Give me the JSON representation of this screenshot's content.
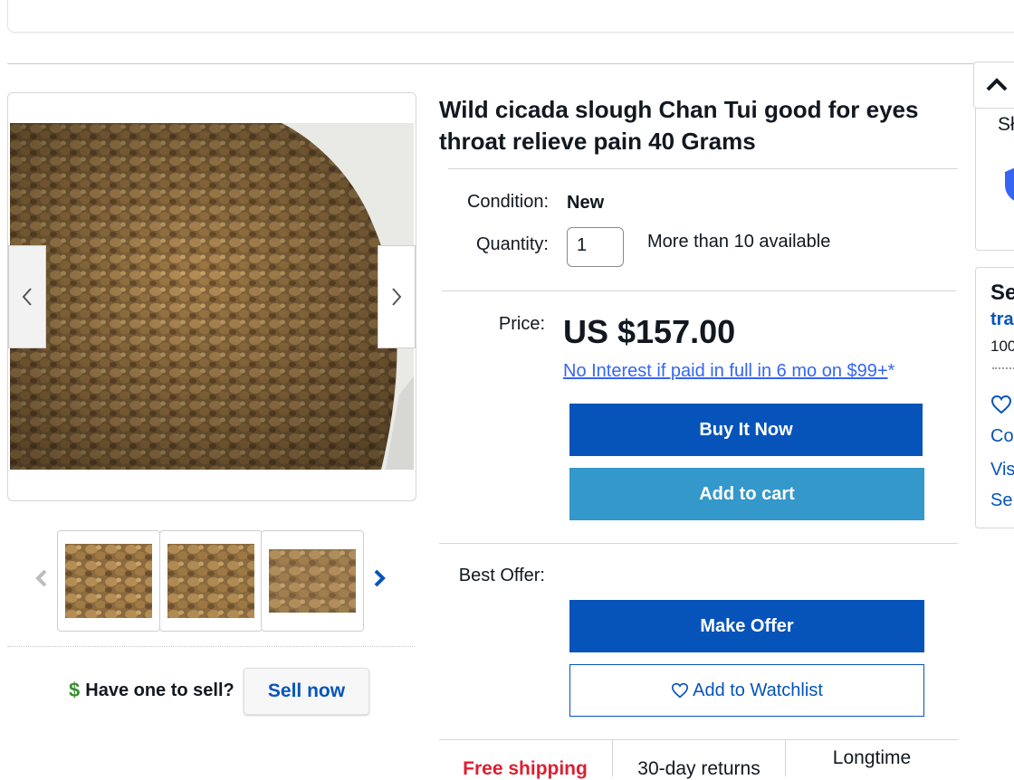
{
  "listing": {
    "title": "Wild cicada slough Chan Tui good for eyes throat relieve pain 40 Grams",
    "condition_label": "Condition:",
    "condition_value": "New",
    "quantity_label": "Quantity:",
    "quantity_value": "1",
    "availability": "More than 10 available",
    "price_label": "Price:",
    "price": "US $157.00",
    "financing_link": "No Interest if paid in full in 6 mo on $99+",
    "financing_asterisk": "*",
    "buy_now": "Buy It Now",
    "add_to_cart": "Add to cart",
    "best_offer_label": "Best Offer:",
    "make_offer": "Make Offer",
    "add_to_watchlist": "Add to Watchlist"
  },
  "gallery": {
    "thumbnail_count": 3
  },
  "sell": {
    "prompt": "Have one to sell?",
    "button": "Sell now"
  },
  "badges": {
    "shipping": "Free shipping",
    "returns": "30-day returns",
    "longtime": "Longtime"
  },
  "right_panel": {
    "card1_text": "Sł",
    "seller_heading": "Se",
    "seller_name": "tra",
    "feedback": "100",
    "link_contact": "Co",
    "link_visit": "Vis",
    "link_see": "Se"
  },
  "colors": {
    "primary_blue": "#0654ba",
    "cart_blue": "#3498ca",
    "link_blue": "#3665f3",
    "shipping_red": "#dd1e31"
  }
}
